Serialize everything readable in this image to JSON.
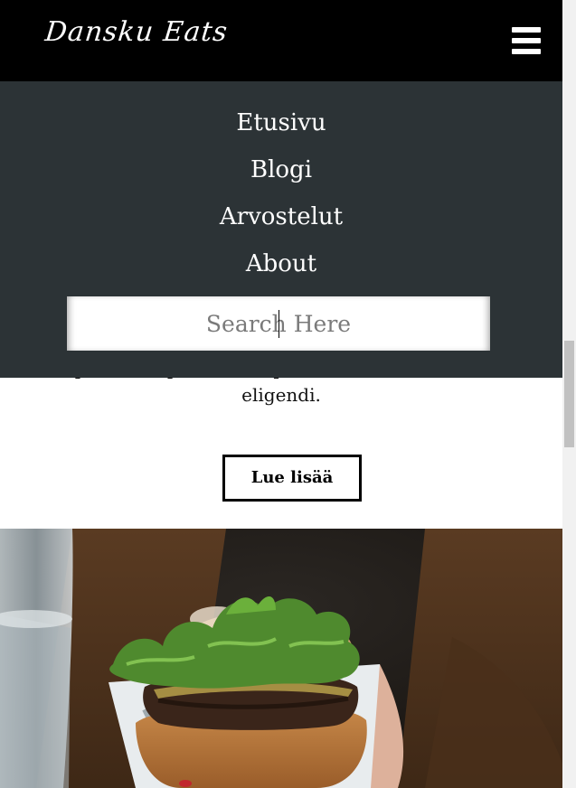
{
  "header": {
    "logo_text": "Dansku Eats"
  },
  "nav": {
    "items": [
      {
        "label": "Etusivu"
      },
      {
        "label": "Blogi"
      },
      {
        "label": "Arvostelut"
      },
      {
        "label": "About"
      }
    ]
  },
  "search": {
    "placeholder": "Search Here",
    "value": ""
  },
  "post": {
    "excerpt": "voluptatum explicabo ad quis maxime, harum ratione eligendi.",
    "read_more_label": "Lue lisää"
  },
  "colors": {
    "header_bg": "#000000",
    "menu_bg": "#2c3336",
    "text_light": "#ffffff"
  },
  "icons": {
    "menu": "hamburger-menu-icon"
  }
}
